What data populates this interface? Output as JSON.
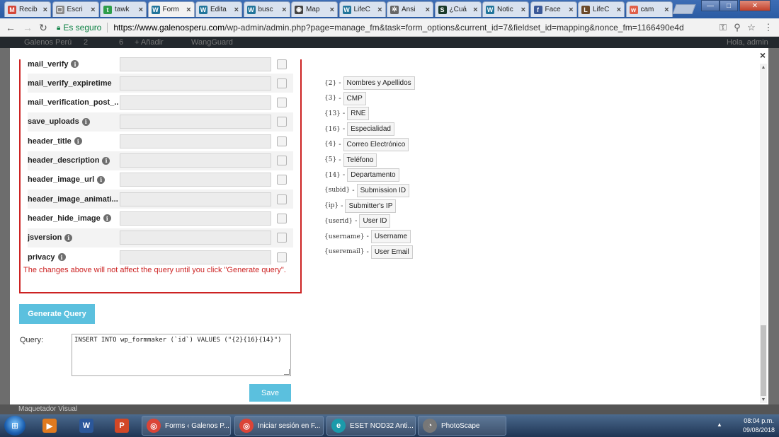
{
  "browser": {
    "tabs": [
      {
        "label": "Recib",
        "icon": "gmail-icon",
        "color": "#d44638",
        "glyph": "M"
      },
      {
        "label": "Escri",
        "icon": "document-icon",
        "color": "#888888",
        "glyph": "▢"
      },
      {
        "label": "tawk",
        "icon": "tawk-icon",
        "color": "#2e9e4b",
        "glyph": "t"
      },
      {
        "label": "Form",
        "icon": "wordpress-icon",
        "color": "#21759b",
        "glyph": "W"
      },
      {
        "label": "Edita",
        "icon": "wordpress-icon",
        "color": "#21759b",
        "glyph": "W"
      },
      {
        "label": "busc",
        "icon": "wordpress-icon",
        "color": "#21759b",
        "glyph": "W"
      },
      {
        "label": "Map",
        "icon": "map-icon",
        "color": "#444444",
        "glyph": "◉"
      },
      {
        "label": "LifeC",
        "icon": "wordpress-icon",
        "color": "#21759b",
        "glyph": "W"
      },
      {
        "label": "Ansi",
        "icon": "puzzle-icon",
        "color": "#666666",
        "glyph": "✲"
      },
      {
        "label": "¿Cuá",
        "icon": "sep-icon",
        "color": "#1a3a2a",
        "glyph": "S"
      },
      {
        "label": "Notic",
        "icon": "wordpress-icon",
        "color": "#21759b",
        "glyph": "W"
      },
      {
        "label": "Face",
        "icon": "facebook-icon",
        "color": "#3b5998",
        "glyph": "f"
      },
      {
        "label": "LifeC",
        "icon": "lifec-icon",
        "color": "#6b4a2a",
        "glyph": "L"
      },
      {
        "label": "cam",
        "icon": "wix-icon",
        "color": "#e0604a",
        "glyph": "w"
      }
    ],
    "active_tab_index": 3,
    "window_controls": {
      "minimize": "—",
      "maximize": "□",
      "close": "✕"
    },
    "secure_label": "Es seguro",
    "url_host": "https://www.galenosperu.com",
    "url_path": "/wp-admin/admin.php?page=manage_fm&task=form_options&current_id=7&fieldset_id=mapping&nonce_fm=1166490e4d"
  },
  "wpbar": {
    "site": "Galenos Perú",
    "updates": "2",
    "comments": "6",
    "new": "+ Añadir",
    "plugin": "WangGuard",
    "greeting": "Hola, admin"
  },
  "modal": {
    "close": "×",
    "fields": [
      {
        "name": "mail_verify",
        "info": true
      },
      {
        "name": "mail_verify_expiretime",
        "info": false
      },
      {
        "name": "mail_verification_post_...",
        "info": false
      },
      {
        "name": "save_uploads",
        "info": true
      },
      {
        "name": "header_title",
        "info": true
      },
      {
        "name": "header_description",
        "info": true
      },
      {
        "name": "header_image_url",
        "info": true
      },
      {
        "name": "header_image_animati...",
        "info": false
      },
      {
        "name": "header_hide_image",
        "info": true
      },
      {
        "name": "jsversion",
        "info": true
      },
      {
        "name": "privacy",
        "info": true
      }
    ],
    "warning": "The changes above will not affect the query until you click \"Generate query\".",
    "generate_label": "Generate Query",
    "query_label": "Query:",
    "query_value": "INSERT INTO wp_formmaker (`id`) VALUES (\"{2}{16}{14}\")",
    "save_label": "Save",
    "placeholders": [
      {
        "code": "{2}",
        "label": "Nombres y Apellidos"
      },
      {
        "code": "{3}",
        "label": "CMP"
      },
      {
        "code": "{13}",
        "label": "RNE"
      },
      {
        "code": "{16}",
        "label": "Especialidad"
      },
      {
        "code": "{4}",
        "label": "Correo Electrónico"
      },
      {
        "code": "{5}",
        "label": "Teléfono"
      },
      {
        "code": "{14}",
        "label": "Departamento"
      },
      {
        "code": "{subid}",
        "label": "Submission ID"
      },
      {
        "code": "{ip}",
        "label": "Submitter's IP"
      },
      {
        "code": "{userid}",
        "label": "User ID"
      },
      {
        "code": "{username}",
        "label": "Username"
      },
      {
        "code": "{useremail}",
        "label": "User Email"
      }
    ]
  },
  "under_label": "Maquetador Visual",
  "taskbar": {
    "pinned": [
      {
        "icon": "media-player-icon",
        "color": "#e07a1f",
        "glyph": "▶"
      },
      {
        "icon": "word-icon",
        "color": "#2b579a",
        "glyph": "W"
      },
      {
        "icon": "powerpoint-icon",
        "color": "#d24726",
        "glyph": "P"
      }
    ],
    "windows": [
      {
        "label": "Forms ‹ Galenos P...",
        "icon": "chrome-icon",
        "color": "#db4437",
        "glyph": "◎"
      },
      {
        "label": "Iniciar sesión en F...",
        "icon": "chrome-icon",
        "color": "#db4437",
        "glyph": "◎"
      },
      {
        "label": "ESET NOD32 Anti...",
        "icon": "eset-icon",
        "color": "#1b9aaa",
        "glyph": "e"
      },
      {
        "label": "PhotoScape",
        "icon": "photoscape-icon",
        "color": "#777777",
        "glyph": "◔"
      }
    ],
    "time": "08:04 p.m.",
    "date": "09/08/2018"
  }
}
